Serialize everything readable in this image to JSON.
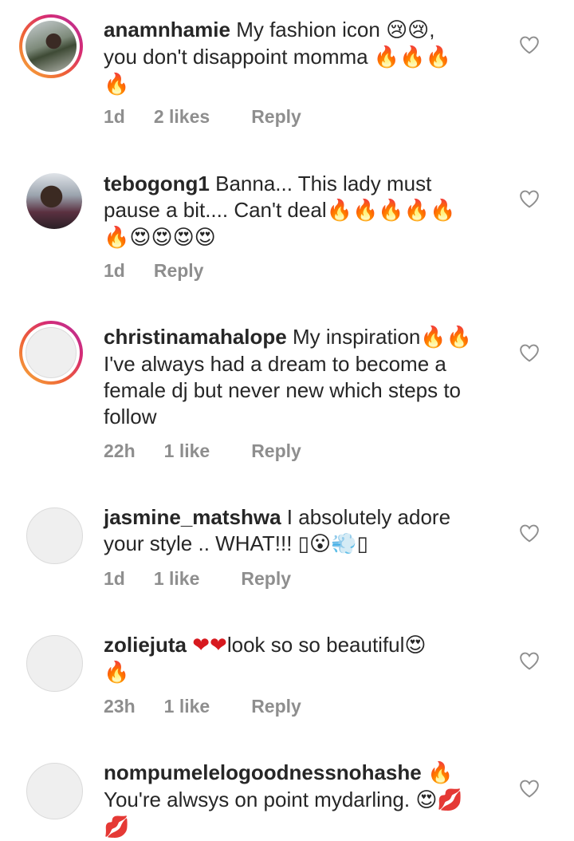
{
  "comments": [
    {
      "username": "anamnhamie",
      "text": "My fashion icon 😢😢, you don't disappoint momma 🔥🔥🔥 🔥",
      "time": "1d",
      "likes": "2 likes",
      "reply": "Reply",
      "story_ring": true
    },
    {
      "username": "tebogong1",
      "text": "Banna... This lady must pause a bit.... Can't deal🔥🔥🔥🔥🔥 🔥😍😍😍😍",
      "time": "1d",
      "likes": "",
      "reply": "Reply",
      "story_ring": false
    },
    {
      "username": "christinamahalope",
      "text": "My inspiration🔥🔥 I've always had a dream to become a female dj but never new which steps to follow",
      "time": "22h",
      "likes": "1 like",
      "reply": "Reply",
      "story_ring": true
    },
    {
      "username": "jasmine_matshwa",
      "text": "I absolutely adore your style .. WHAT!!! ▯😮💨▯",
      "time": "1d",
      "likes": "1 like",
      "reply": "Reply",
      "story_ring": false
    },
    {
      "username": "zoliejuta",
      "text": "❤❤look so so beautiful😍 🔥",
      "time": "23h",
      "likes": "1 like",
      "reply": "Reply",
      "story_ring": false
    },
    {
      "username": "nompumelelogoodnessnohashe",
      "text": "🔥 You're alwsys on point mydarling. 😍💋 💋",
      "time": "",
      "likes": "",
      "reply": "",
      "story_ring": false
    }
  ]
}
